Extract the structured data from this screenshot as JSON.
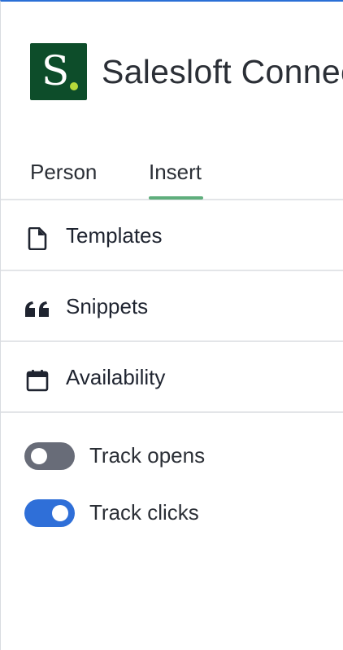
{
  "header": {
    "logo_letter": "S",
    "app_title": "Salesloft Connect"
  },
  "tabs": [
    {
      "label": "Person",
      "active": false
    },
    {
      "label": "Insert",
      "active": true
    }
  ],
  "menu": [
    {
      "label": "Templates",
      "icon": "file-icon"
    },
    {
      "label": "Snippets",
      "icon": "quote-icon"
    },
    {
      "label": "Availability",
      "icon": "calendar-icon"
    }
  ],
  "toggles": [
    {
      "label": "Track opens",
      "state": false
    },
    {
      "label": "Track clicks",
      "state": true
    }
  ],
  "colors": {
    "brand_green": "#0d4d2a",
    "logo_dot": "#b6d93a",
    "tab_underline": "#5fae7c",
    "toggle_on": "#2f6fd8",
    "toggle_off": "#686c78"
  }
}
